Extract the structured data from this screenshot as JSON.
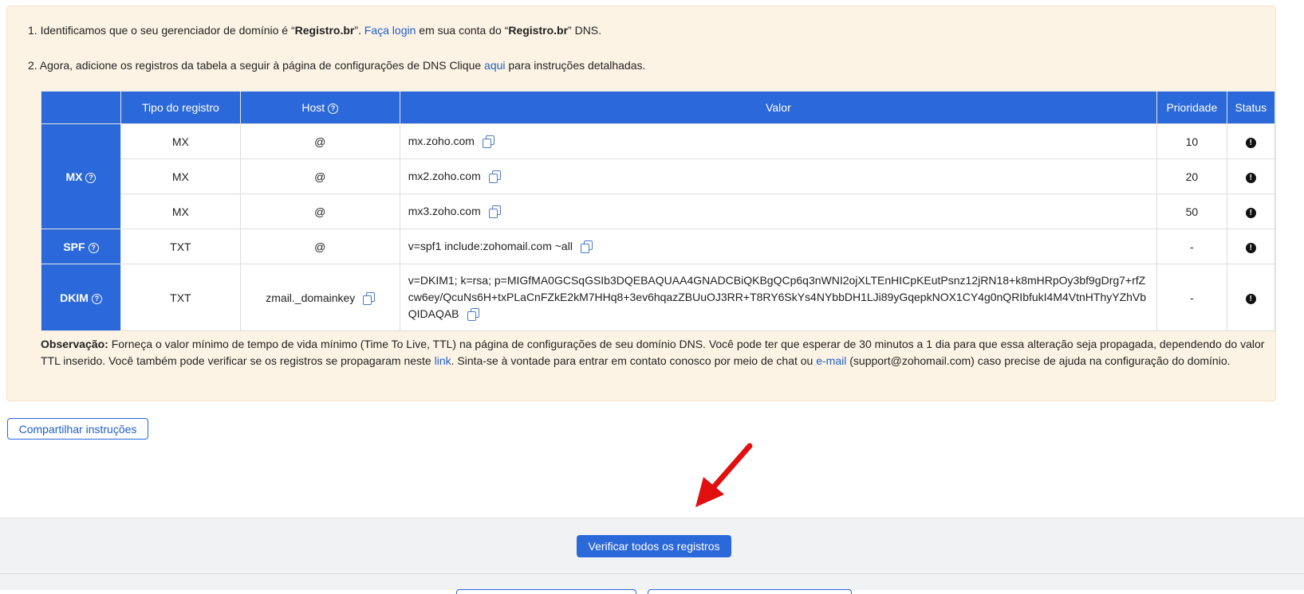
{
  "instructions": {
    "step1": {
      "prefix": "1. Identificamos que o seu gerenciador de domínio é “",
      "registrar": "Registro.br",
      "mid": "”. ",
      "login_link": "Faça login",
      "after_link": " em sua conta do “",
      "registrar2": "Registro.br",
      "suffix": "” DNS."
    },
    "step2": {
      "prefix": "2. Agora, adicione os registros da tabela a seguir à página de configurações de DNS Clique ",
      "link": "aqui",
      "suffix": " para instruções detalhadas."
    }
  },
  "table": {
    "headers": {
      "category": "",
      "type": "Tipo do registro",
      "host": "Host",
      "value": "Valor",
      "priority": "Prioridade",
      "status": "Status"
    },
    "categories": {
      "mx": "MX",
      "spf": "SPF",
      "dkim": "DKIM"
    },
    "rows": [
      {
        "type": "MX",
        "host": "@",
        "value": "mx.zoho.com",
        "priority": "10",
        "status": "!"
      },
      {
        "type": "MX",
        "host": "@",
        "value": "mx2.zoho.com",
        "priority": "20",
        "status": "!"
      },
      {
        "type": "MX",
        "host": "@",
        "value": "mx3.zoho.com",
        "priority": "50",
        "status": "!"
      },
      {
        "type": "TXT",
        "host": "@",
        "value": "v=spf1 include:zohomail.com ~all",
        "priority": "-",
        "status": "!"
      },
      {
        "type": "TXT",
        "host": "zmail._domainkey",
        "value": "v=DKIM1; k=rsa; p=MIGfMA0GCSqGSIb3DQEBAQUAA4GNADCBiQKBgQCp6q3nWNI2ojXLTEnHICpKEutPsnz12jRN18+k8mHRpOy3bf9gDrg7+rfZcw6ey/QcuNs6H+txPLaCnFZkE2kM7HHq8+3ev6hqazZBUuOJ3RR+T8RY6SkYs4NYbbDH1LJi89yGqepkNOX1CY4g0nQRIbfukI4M4VtnHThyYZhVbQIDAQAB",
        "priority": "-",
        "status": "!"
      }
    ]
  },
  "note": {
    "label": "Observação:",
    "text1": " Forneça o valor mínimo de tempo de vida mínimo (Time To Live, TTL) na página de configurações de seu domínio DNS. Você pode ter que esperar de 30 minutos a 1 dia para que essa alteração seja propagada, dependendo do valor TTL inserido. Você também pode verificar se os registros se propagaram neste ",
    "link1": "link",
    "text2": ". Sinta-se à vontade para entrar em contato conosco por meio de chat ou ",
    "link2": "e-mail",
    "text3": " (support@zohomail.com) caso precise de ajuda na configuração do domínio."
  },
  "buttons": {
    "share": "Compartilhar instruções",
    "verify": "Verificar todos os registros"
  },
  "colors": {
    "accent": "#2b68d9",
    "panel_bg": "#fdf3e4",
    "arrow": "#e01010"
  },
  "icons": {
    "help": "question-circle-icon",
    "copy": "copy-icon",
    "status": "exclamation-circle-icon",
    "arrow": "red-arrow-pointer"
  }
}
